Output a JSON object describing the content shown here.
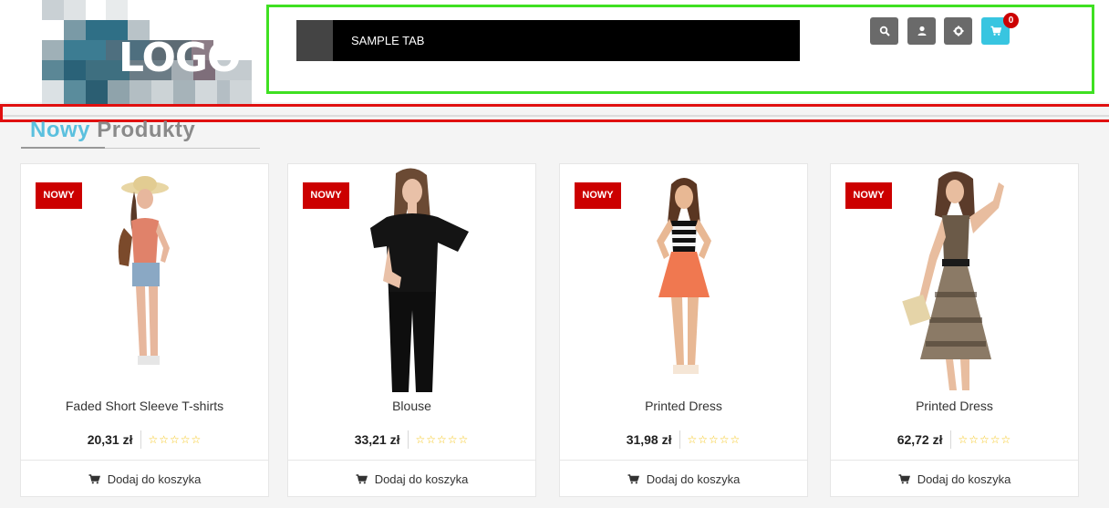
{
  "logo": {
    "text": "LOGO"
  },
  "nav": {
    "tab_label": "SAMPLE TAB"
  },
  "header_buttons": {
    "cart_count": "0"
  },
  "section": {
    "title_part1": "Nowy",
    "title_part2": "Produkty"
  },
  "colors": {
    "accent": "#5bc0de",
    "badge_red": "#cc0000",
    "cart_button": "#38c5e0",
    "nav_border": "#3fe022"
  },
  "icons": [
    "search-icon",
    "user-icon",
    "gear-icon",
    "cart-icon"
  ],
  "products": [
    {
      "badge": "NOWY",
      "name": "Faded Short Sleeve T-shirts",
      "price": "20,31 zł",
      "stars": "☆☆☆☆☆",
      "add_label": "Dodaj do koszyka"
    },
    {
      "badge": "NOWY",
      "name": "Blouse",
      "price": "33,21 zł",
      "stars": "☆☆☆☆☆",
      "add_label": "Dodaj do koszyka"
    },
    {
      "badge": "NOWY",
      "name": "Printed Dress",
      "price": "31,98 zł",
      "stars": "☆☆☆☆☆",
      "add_label": "Dodaj do koszyka"
    },
    {
      "badge": "NOWY",
      "name": "Printed Dress",
      "price": "62,72 zł",
      "stars": "☆☆☆☆☆",
      "add_label": "Dodaj do koszyka"
    }
  ]
}
